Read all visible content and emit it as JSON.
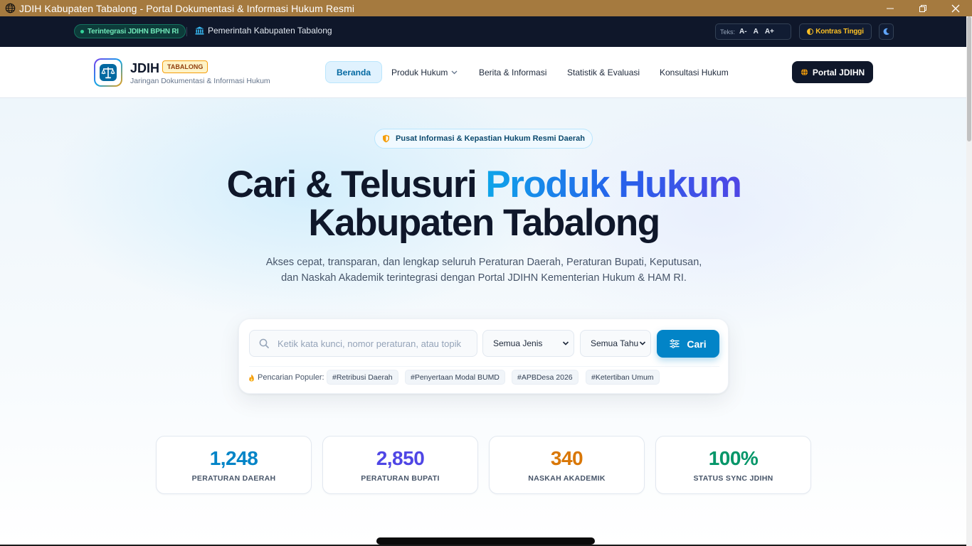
{
  "window": {
    "title": "JDIH Kabupaten Tabalong - Portal Dokumentasi & Informasi Hukum Resmi"
  },
  "utility": {
    "integration_badge": "Terintegrasi JDIHN BPHN RI",
    "government": "Pemerintah Kabupaten Tabalong",
    "text_size_label": "Teks:",
    "text_decrease": "A-",
    "text_normal": "A",
    "text_increase": "A+",
    "contrast_label": "Kontras Tinggi"
  },
  "header": {
    "brand": "JDIH",
    "brand_tag": "TABALONG",
    "brand_sub": "Jaringan Dokumentasi & Informasi Hukum",
    "nav": [
      {
        "label": "Beranda"
      },
      {
        "label": "Produk Hukum"
      },
      {
        "label": "Berita & Informasi"
      },
      {
        "label": "Statistik & Evaluasi"
      },
      {
        "label": "Konsultasi Hukum"
      }
    ],
    "portal_button": "Portal JDIHN"
  },
  "hero": {
    "badge": "Pusat Informasi & Kepastian Hukum Resmi Daerah",
    "title_part1": "Cari & Telusuri ",
    "title_highlight": "Produk Hukum",
    "title_line2": "Kabupaten Tabalong",
    "lead": "Akses cepat, transparan, dan lengkap seluruh Peraturan Daerah, Peraturan Bupati, Keputusan, dan Naskah Akademik terintegrasi dengan Portal JDIHN Kementerian Hukum & HAM RI."
  },
  "search": {
    "placeholder": "Ketik kata kunci, nomor peraturan, atau topik",
    "type_select": "Semua Jenis",
    "year_select": "Semua Tahu",
    "button": "Cari",
    "popular_label": "Pencarian Populer:",
    "popular_tags": [
      "#Retribusi Daerah",
      "#Penyertaan Modal BUMD",
      "#APBDesa 2026",
      "#Ketertiban Umum"
    ]
  },
  "stats": [
    {
      "value": "1,248",
      "label": "PERATURAN DAERAH",
      "color": "#0284c7"
    },
    {
      "value": "2,850",
      "label": "PERATURAN BUPATI",
      "color": "#4f46e5"
    },
    {
      "value": "340",
      "label": "NASKAH AKADEMIK",
      "color": "#d97706"
    },
    {
      "value": "100%",
      "label": "STATUS SYNC JDIHN",
      "color": "#059669"
    }
  ],
  "colors": {
    "titlebar": "#a57a3f",
    "utility_bar": "#0f172a",
    "accent": "#0284c7",
    "portal_button": "#0f172a"
  }
}
